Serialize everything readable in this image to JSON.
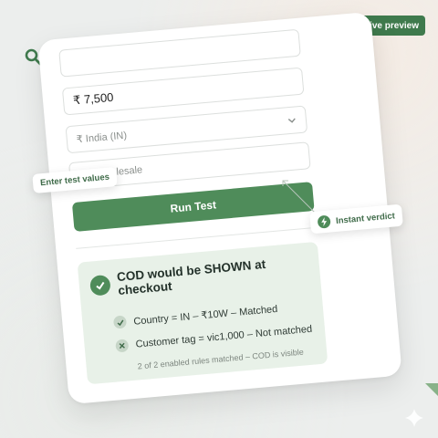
{
  "preview_badge": "Live preview",
  "form": {
    "amount_value": "₹ 7,500",
    "country_placeholder": "₹  India (IN)",
    "tag_placeholder": "vip, wholesale",
    "run_label": "Run Test"
  },
  "result": {
    "title": "COD would be SHOWN at checkout",
    "rules": [
      {
        "text": "Country = IN – ₹10W – Matched",
        "status": "matched"
      },
      {
        "text": "Customer tag = vic1,000 – Not matched",
        "status": "not-matched"
      }
    ],
    "summary": "2 of 2 enabled rules matched – COD is visible"
  },
  "callouts": {
    "enter": "Enter test values",
    "verdict": "Instant verdict"
  },
  "icons": {
    "search": "search-icon",
    "chevron": "chevron-down-icon",
    "check": "check-icon",
    "x": "x-icon",
    "bolt": "bolt-icon"
  },
  "colors": {
    "accent": "#4f8c5a",
    "badge": "#3f7a4d",
    "result_bg": "#e8f1e8"
  }
}
